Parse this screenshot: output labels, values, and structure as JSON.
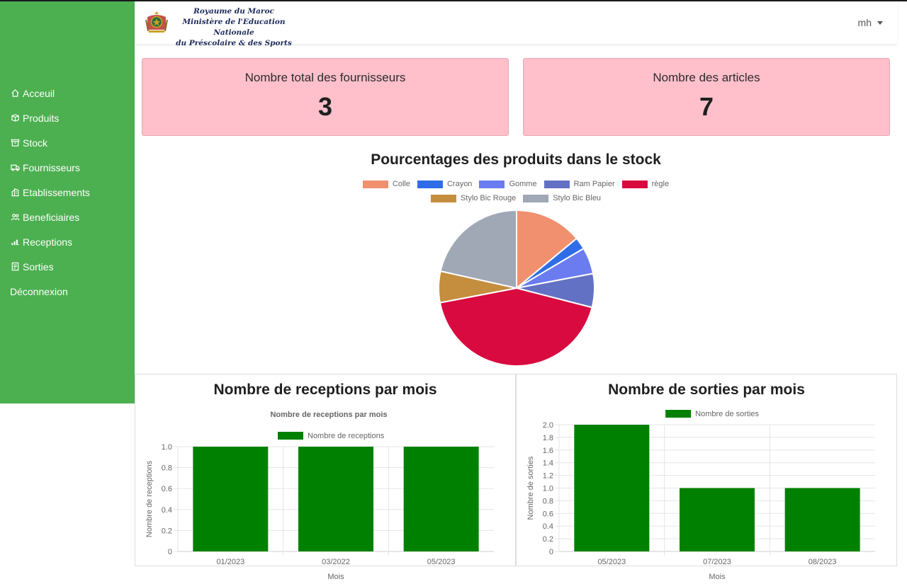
{
  "header": {
    "ministry_line1": "Royaume du Maroc",
    "ministry_line2": "Ministère de l'Education Nationale",
    "ministry_line3": "du Préscolaire & des Sports",
    "user": "mh"
  },
  "sidebar": {
    "items": [
      {
        "label": "Acceuil",
        "icon": "home-icon"
      },
      {
        "label": "Produits",
        "icon": "box-icon"
      },
      {
        "label": "Stock",
        "icon": "archive-icon"
      },
      {
        "label": "Fournisseurs",
        "icon": "truck-icon"
      },
      {
        "label": "Etablissements",
        "icon": "building-icon"
      },
      {
        "label": "Beneficiaires",
        "icon": "people-icon"
      },
      {
        "label": "Receptions",
        "icon": "bar-chart-icon"
      },
      {
        "label": "Sorties",
        "icon": "receipt-icon"
      },
      {
        "label": "Déconnexion",
        "icon": ""
      }
    ]
  },
  "cards": {
    "suppliers_label": "Nombre total des fournisseurs",
    "suppliers_value": "3",
    "articles_label": "Nombre des articles",
    "articles_value": "7"
  },
  "colors": {
    "sidebar": "#4caf50",
    "card": "#ffc0cb",
    "bar": "#008000"
  },
  "chart_data": [
    {
      "type": "pie",
      "title": "Pourcentages des produits dans le stock",
      "labels": [
        "Colle",
        "Crayon",
        "Gomme",
        "Ram Papier",
        "règle",
        "Stylo Bic  Rouge",
        "Stylo Bic Bleu"
      ],
      "values": [
        14,
        2.5,
        5.5,
        7,
        43,
        6.5,
        21.5
      ],
      "colors": [
        "#f0906e",
        "#2f6de8",
        "#6a7cf0",
        "#6371c4",
        "#d90a3f",
        "#c48e3e",
        "#a0a7b5"
      ],
      "legend": "top"
    },
    {
      "type": "bar",
      "title": "Nombre de receptions par mois",
      "subtitle": "Nombre de receptions par mois",
      "categories": [
        "01/2023",
        "03/2022",
        "05/2023"
      ],
      "series": [
        {
          "name": "Nombre de receptions",
          "values": [
            1,
            1,
            1
          ]
        }
      ],
      "xlabel": "Mois",
      "ylabel": "Nombre de receptions",
      "ylim": [
        0,
        1
      ],
      "yticks": [
        "0",
        "0.2",
        "0.4",
        "0.6",
        "0.8",
        "1.0"
      ],
      "grid": true
    },
    {
      "type": "bar",
      "title": "Nombre de sorties par mois",
      "categories": [
        "05/2023",
        "07/2023",
        "08/2023"
      ],
      "series": [
        {
          "name": "Nombre de sorties",
          "values": [
            2,
            1,
            1
          ]
        }
      ],
      "xlabel": "Mois",
      "ylabel": "Nombre de sorties",
      "ylim": [
        0,
        2
      ],
      "yticks": [
        "0",
        "0.2",
        "0.4",
        "0.6",
        "0.8",
        "1.0",
        "1.2",
        "1.4",
        "1.6",
        "1.8",
        "2.0"
      ],
      "grid": true
    }
  ]
}
